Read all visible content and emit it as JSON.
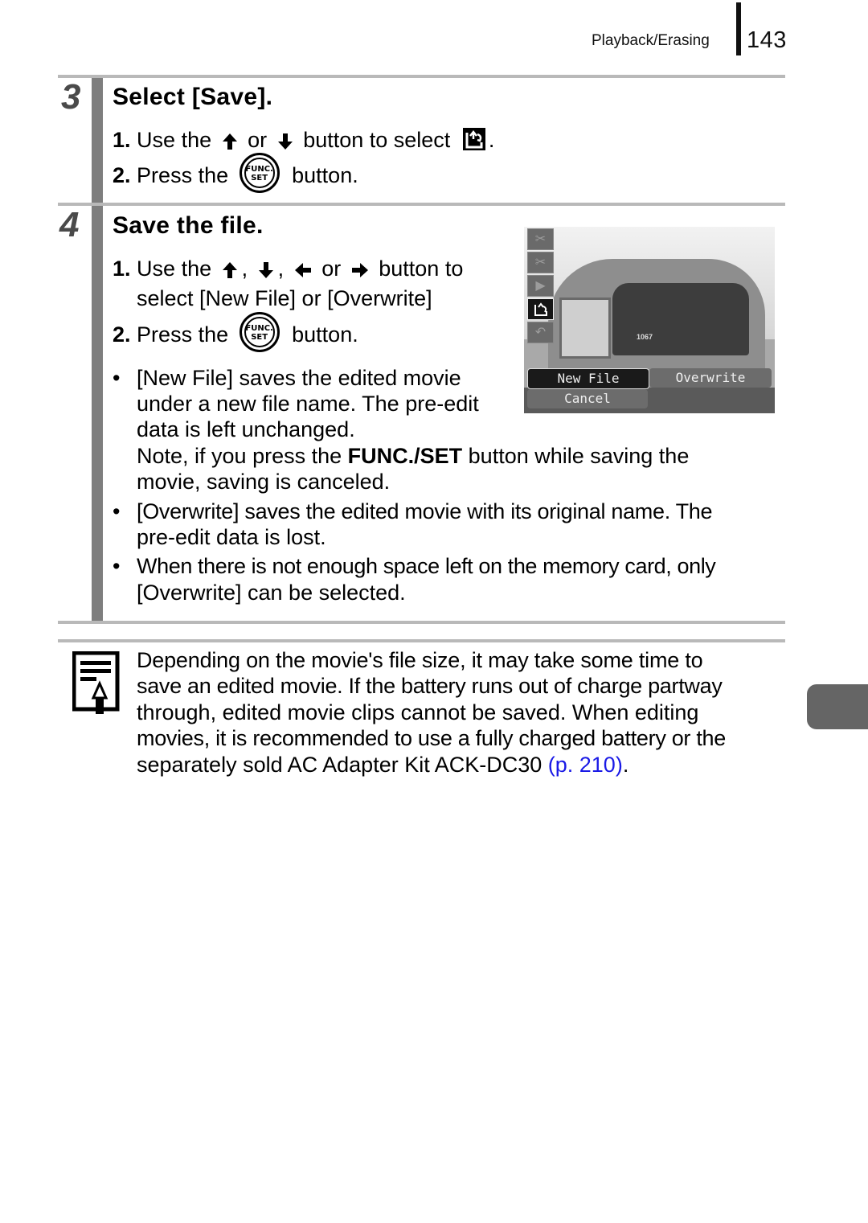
{
  "header": {
    "section_name": "Playback/Erasing",
    "page_number": "143"
  },
  "steps": [
    {
      "number": "3",
      "title": "Select [Save].",
      "instructions": [
        {
          "num": "1.",
          "before": "Use the",
          "arrows": [
            "up-arrow",
            "down-arrow"
          ],
          "joiners": [
            "or"
          ],
          "after": "button to select",
          "icon": "save-icon",
          "end": "."
        },
        {
          "num": "2.",
          "before": "Press the",
          "button_top": "FUNC.",
          "button_bottom": "SET",
          "after": "button."
        }
      ]
    },
    {
      "number": "4",
      "title": "Save the file.",
      "instructions": [
        {
          "num": "1.",
          "before": "Use the",
          "sep1": ",",
          "sep2": ",",
          "or": "or",
          "after": "button to",
          "line2": "select [New File] or [Overwrite]"
        },
        {
          "num": "2.",
          "before": "Press the",
          "button_top": "FUNC.",
          "button_bottom": "SET",
          "after": "button."
        }
      ],
      "bullets": [
        {
          "lines": [
            "[New File] saves the edited movie",
            "under a new file name. The pre-edit",
            "data is left unchanged."
          ]
        },
        {
          "note_pre": "Note, if you press the ",
          "note_bold": "FUNC./SET",
          "note_post": " button while saving the",
          "note_line2": "movie, saving is canceled."
        },
        {
          "lines": [
            "[Overwrite] saves the edited movie with its original name. The",
            "pre-edit data is lost."
          ]
        },
        {
          "lines": [
            "When there is not enough space left on the memory card, only",
            "[Overwrite] can be selected."
          ]
        }
      ],
      "screen": {
        "menu_icons": [
          "scissors-cut-front-icon",
          "scissors-cut-back-icon",
          "play-icon",
          "save-icon",
          "return-icon"
        ],
        "active_icon": "save-icon",
        "options": {
          "new_file": "New File",
          "overwrite": "Overwrite",
          "cancel": "Cancel"
        },
        "selected_option": "New File",
        "train_number": "1067"
      }
    }
  ],
  "note": {
    "lines": [
      "Depending on the movie's file size, it may take some time to",
      "save an edited movie. If the battery runs out of charge partway",
      "through, edited movie clips cannot be saved. When editing",
      "movies, it is recommended to use a fully charged battery or the"
    ],
    "last_line_pre": "separately sold AC Adapter Kit ACK-DC30 ",
    "link": "(p. 210)",
    "last_line_post": ".",
    "link_color": "#1a1ae6"
  },
  "colors": {
    "rule": "#b9b9b9",
    "step_bar": "#7e7e7e",
    "side_tab": "#656565"
  }
}
